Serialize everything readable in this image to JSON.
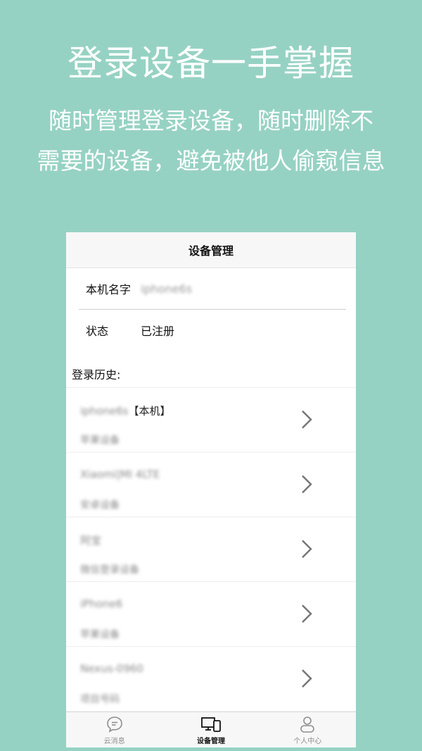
{
  "promo": {
    "headline": "登录设备一手掌握",
    "line1": "随时管理登录设备，随时删除不",
    "line2": "需要的设备，避免被他人偷窥信息"
  },
  "screen": {
    "title": "设备管理",
    "info": {
      "name_label": "本机名字",
      "name_value": "iphone6s",
      "status_label": "状态",
      "status_value": "已注册"
    },
    "history_label": "登录历史:",
    "devices": [
      {
        "name": "iphone6s",
        "suffix": "【本机】",
        "type": "苹果设备"
      },
      {
        "name": "Xiaomi|MI 4LTE",
        "suffix": "",
        "type": "安卓设备"
      },
      {
        "name": "阿宝",
        "suffix": "",
        "type": "微信登录设备"
      },
      {
        "name": "iPhone6",
        "suffix": "",
        "type": "苹果设备"
      },
      {
        "name": "Nexus-0960",
        "suffix": "",
        "type": "项目号码"
      }
    ],
    "tabs": [
      {
        "label": "云消息",
        "icon": "chat-bubble-icon",
        "active": false
      },
      {
        "label": "设备管理",
        "icon": "devices-icon",
        "active": true
      },
      {
        "label": "个人中心",
        "icon": "person-icon",
        "active": false
      }
    ]
  },
  "colors": {
    "background": "#96d2c3",
    "chevron": "#777777"
  }
}
